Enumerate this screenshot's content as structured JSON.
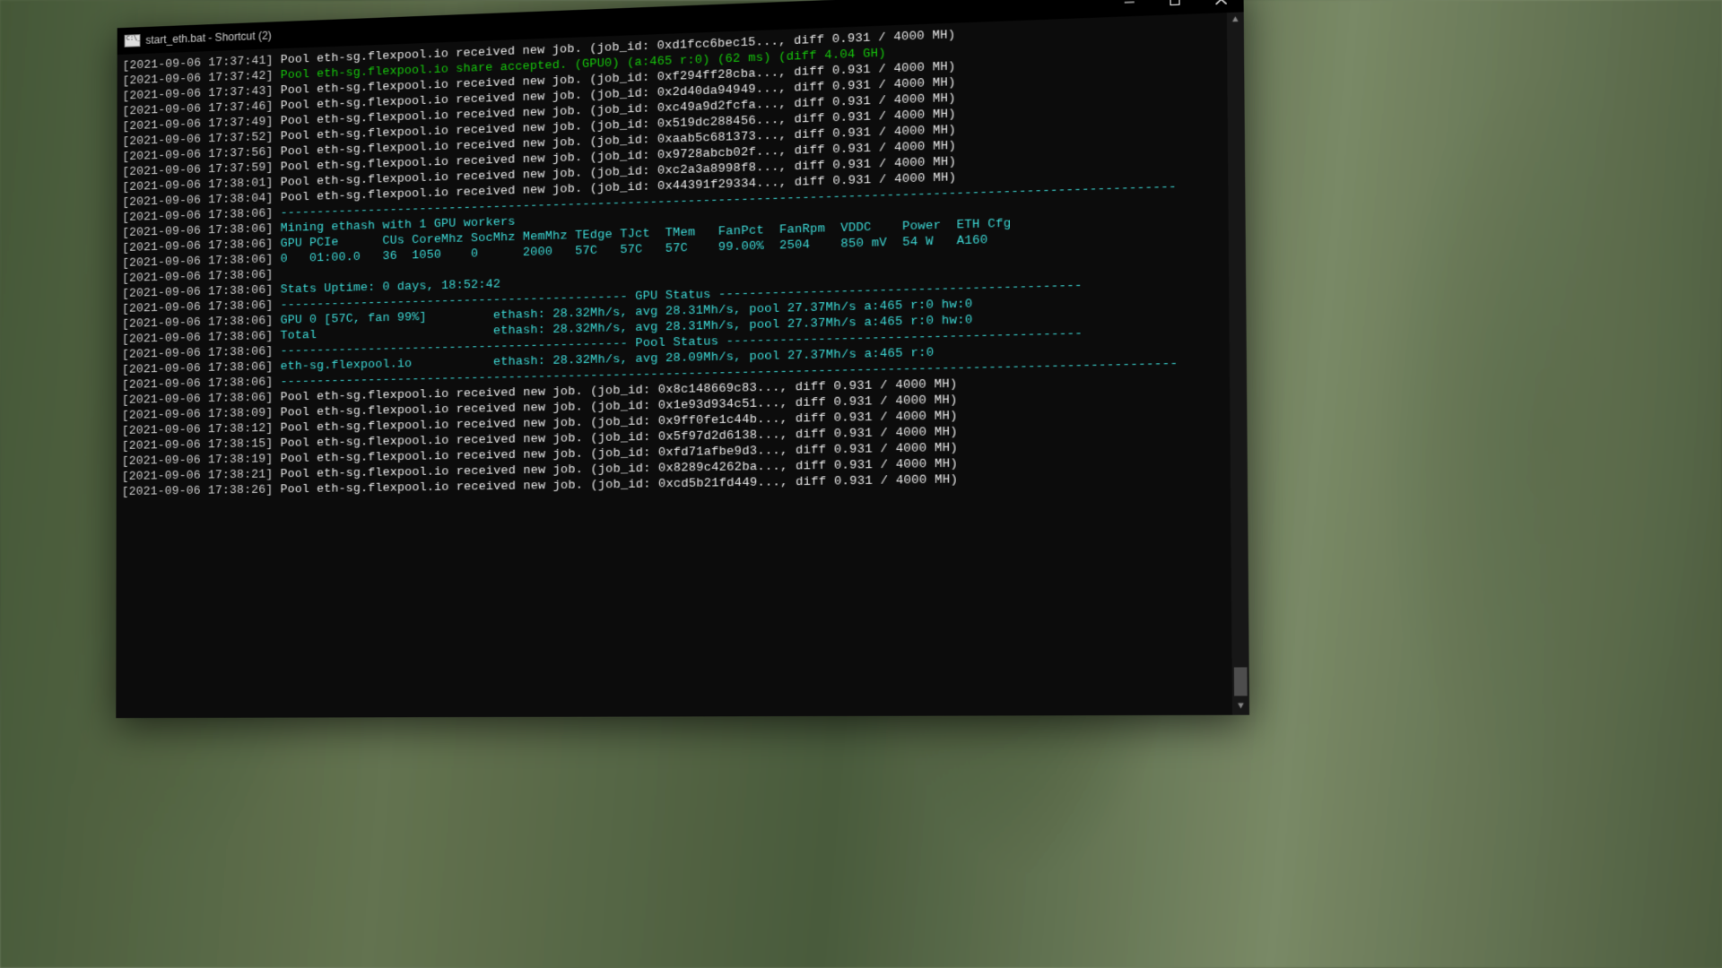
{
  "window": {
    "title": "start_eth.bat - Shortcut (2)"
  },
  "pool": "eth-sg.flexpool.io",
  "jobs_before": [
    {
      "ts": "2021-09-06 17:37:41",
      "id": "0xd1fcc6bec15",
      "diff": "0.931",
      "mh": "4000"
    },
    {
      "ts": "2021-09-06 17:37:43",
      "id": "0xf294ff28cba",
      "diff": "0.931",
      "mh": "4000"
    },
    {
      "ts": "2021-09-06 17:37:46",
      "id": "0x2d40da94949",
      "diff": "0.931",
      "mh": "4000"
    },
    {
      "ts": "2021-09-06 17:37:49",
      "id": "0xc49a9d2fcfa",
      "diff": "0.931",
      "mh": "4000"
    },
    {
      "ts": "2021-09-06 17:37:52",
      "id": "0x519dc288456",
      "diff": "0.931",
      "mh": "4000"
    },
    {
      "ts": "2021-09-06 17:37:56",
      "id": "0xaab5c681373",
      "diff": "0.931",
      "mh": "4000"
    },
    {
      "ts": "2021-09-06 17:37:59",
      "id": "0x9728abcb02f",
      "diff": "0.931",
      "mh": "4000"
    },
    {
      "ts": "2021-09-06 17:38:01",
      "id": "0xc2a3a8998f8",
      "diff": "0.931",
      "mh": "4000"
    },
    {
      "ts": "2021-09-06 17:38:04",
      "id": "0x44391f29334",
      "diff": "0.931",
      "mh": "4000"
    }
  ],
  "share": {
    "ts": "2021-09-06 17:37:42",
    "gpu": "GPU0",
    "a": "465",
    "r": "0",
    "ms": "62",
    "diff": "4.04 GH"
  },
  "stats_ts": "2021-09-06 17:38:06",
  "mining_header": "Mining ethash with 1 GPU workers",
  "table": {
    "headers": [
      "GPU",
      "PCIe",
      "CUs",
      "CoreMhz",
      "SocMhz",
      "MemMhz",
      "TEdge",
      "TJct",
      "TMem",
      "FanPct",
      "FanRpm",
      "VDDC",
      "Power",
      "ETH Cfg"
    ],
    "row": [
      "0",
      "01:00.0",
      "36",
      "1050",
      "0",
      "2000",
      "57C",
      "57C",
      "57C",
      "99.00%",
      "2504",
      "850 mV",
      "54 W",
      "A160"
    ]
  },
  "uptime": "Stats Uptime: 0 days, 18:52:42",
  "gpu_status_title": "GPU Status",
  "pool_status_title": "Pool Status",
  "gpu0": {
    "label": "GPU 0 [57C, fan 99%]",
    "line": "ethash: 28.32Mh/s, avg 28.31Mh/s, pool 27.37Mh/s a:465 r:0 hw:0"
  },
  "total": {
    "label": "Total",
    "line": "ethash: 28.32Mh/s, avg 28.31Mh/s, pool 27.37Mh/s a:465 r:0 hw:0"
  },
  "poolrow": {
    "label": "eth-sg.flexpool.io",
    "line": "ethash: 28.32Mh/s, avg 28.09Mh/s, pool 27.37Mh/s a:465 r:0"
  },
  "jobs_after": [
    {
      "ts": "2021-09-06 17:38:06",
      "id": "0x8c148669c83",
      "diff": "0.931",
      "mh": "4000"
    },
    {
      "ts": "2021-09-06 17:38:09",
      "id": "0x1e93d934c51",
      "diff": "0.931",
      "mh": "4000"
    },
    {
      "ts": "2021-09-06 17:38:12",
      "id": "0x9ff0fe1c44b",
      "diff": "0.931",
      "mh": "4000"
    },
    {
      "ts": "2021-09-06 17:38:15",
      "id": "0x5f97d2d6138",
      "diff": "0.931",
      "mh": "4000"
    },
    {
      "ts": "2021-09-06 17:38:19",
      "id": "0xfd71afbe9d3",
      "diff": "0.931",
      "mh": "4000"
    },
    {
      "ts": "2021-09-06 17:38:21",
      "id": "0x8289c4262ba",
      "diff": "0.931",
      "mh": "4000"
    },
    {
      "ts": "2021-09-06 17:38:26",
      "id": "0xcd5b21fd449",
      "diff": "0.931",
      "mh": "4000"
    }
  ]
}
